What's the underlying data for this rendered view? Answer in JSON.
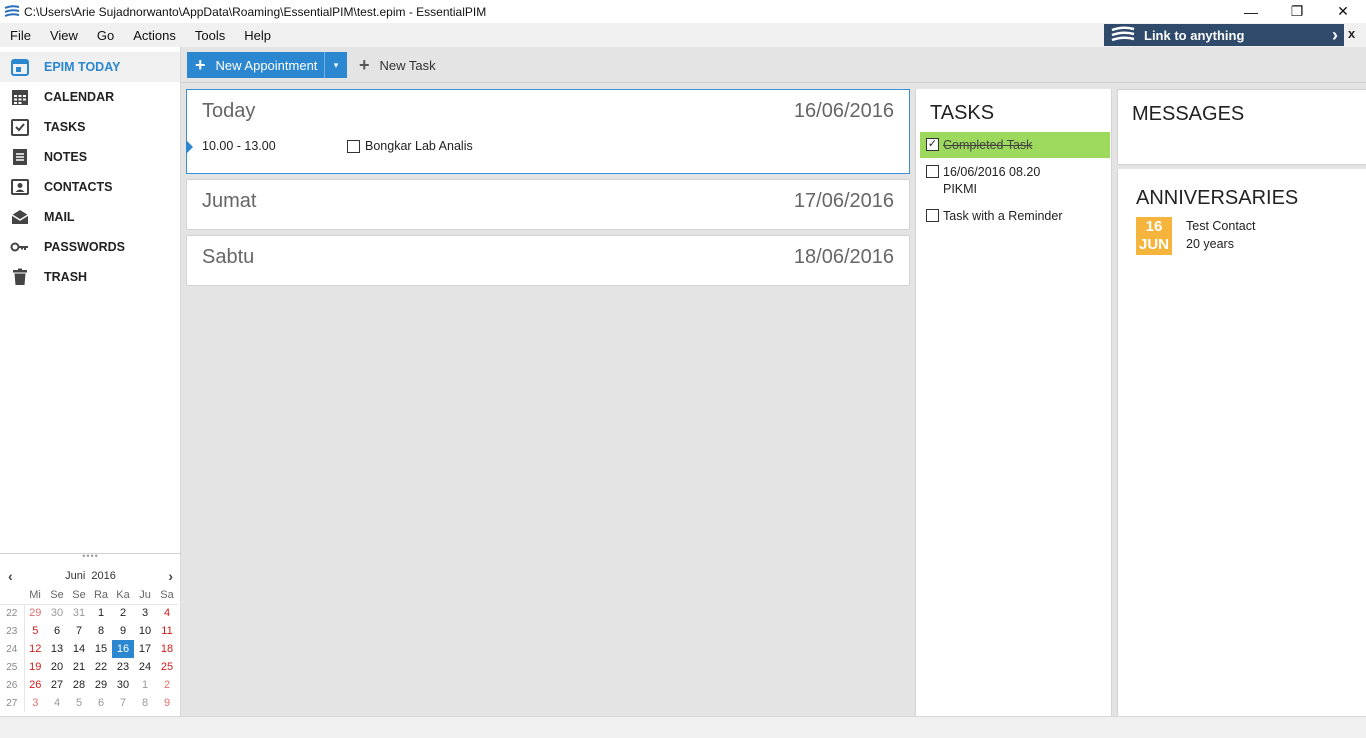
{
  "window": {
    "title": "C:\\Users\\Arie Sujadnorwanto\\AppData\\Roaming\\EssentialPIM\\test.epim - EssentialPIM",
    "minimize": "—",
    "restore": "❐",
    "close": "✕"
  },
  "menu": [
    "File",
    "View",
    "Go",
    "Actions",
    "Tools",
    "Help"
  ],
  "link_banner": {
    "label": "Link to anything",
    "close": "x"
  },
  "sidebar": {
    "items": [
      {
        "label": "EPIM TODAY",
        "icon": "today-icon",
        "active": true
      },
      {
        "label": "CALENDAR",
        "icon": "calendar-icon"
      },
      {
        "label": "TASKS",
        "icon": "tasks-icon"
      },
      {
        "label": "NOTES",
        "icon": "notes-icon"
      },
      {
        "label": "CONTACTS",
        "icon": "contacts-icon"
      },
      {
        "label": "MAIL",
        "icon": "mail-icon"
      },
      {
        "label": "PASSWORDS",
        "icon": "key-icon"
      },
      {
        "label": "TRASH",
        "icon": "trash-icon"
      }
    ]
  },
  "minical": {
    "month": "Juni",
    "year": "2016",
    "weekdays": [
      "Mi",
      "Se",
      "Se",
      "Ra",
      "Ka",
      "Ju",
      "Sa"
    ],
    "weeks": [
      {
        "wk": "22",
        "days": [
          "29",
          "30",
          "31",
          "1",
          "2",
          "3",
          "4"
        ]
      },
      {
        "wk": "23",
        "days": [
          "5",
          "6",
          "7",
          "8",
          "9",
          "10",
          "11"
        ]
      },
      {
        "wk": "24",
        "days": [
          "12",
          "13",
          "14",
          "15",
          "16",
          "17",
          "18"
        ]
      },
      {
        "wk": "25",
        "days": [
          "19",
          "20",
          "21",
          "22",
          "23",
          "24",
          "25"
        ]
      },
      {
        "wk": "26",
        "days": [
          "26",
          "27",
          "28",
          "29",
          "30",
          "1",
          "2"
        ]
      },
      {
        "wk": "27",
        "days": [
          "3",
          "4",
          "5",
          "6",
          "7",
          "8",
          "9"
        ]
      }
    ],
    "today": "16"
  },
  "toolbar": {
    "new_appointment": "New Appointment",
    "new_task": "New Task"
  },
  "days": [
    {
      "name": "Today",
      "date": "16/06/2016",
      "appointment": {
        "time": "10.00 - 13.00",
        "title": "Bongkar Lab Analis"
      }
    },
    {
      "name": "Jumat",
      "date": "17/06/2016"
    },
    {
      "name": "Sabtu",
      "date": "18/06/2016"
    }
  ],
  "tasks": {
    "title": "TASKS",
    "items": [
      {
        "text": "Completed Task",
        "done": true
      },
      {
        "text": "16/06/2016 08.20",
        "text2": "PIKMI",
        "done": false
      },
      {
        "text": "Task with a Reminder",
        "done": false
      }
    ]
  },
  "messages": {
    "title": "MESSAGES"
  },
  "anniversaries": {
    "title": "ANNIVERSARIES",
    "items": [
      {
        "day": "16",
        "month": "JUN",
        "name": "Test Contact",
        "years": "20 years"
      }
    ]
  },
  "colors": {
    "accent": "#2a87d0",
    "banner": "#2f4a6b",
    "task_done": "#9cd95c",
    "anniversary": "#f5b43b",
    "weekend_red": "#d01c1c"
  }
}
